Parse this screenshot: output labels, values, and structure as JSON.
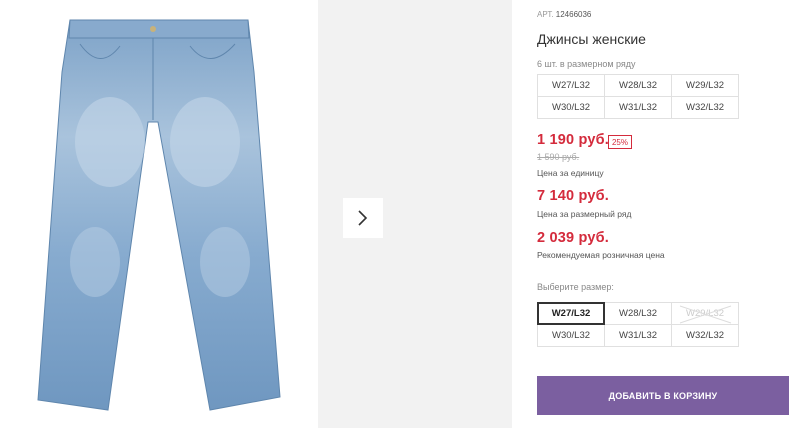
{
  "product": {
    "art_label": "АРТ.",
    "art_value": "12466036",
    "title": "Джинсы женские",
    "row_note": "6 шт. в размерном ряду"
  },
  "row_sizes": [
    "W27/L32",
    "W28/L32",
    "W29/L32",
    "W30/L32",
    "W31/L32",
    "W32/L32"
  ],
  "prices": {
    "unit_price": "1 190 руб.",
    "discount_badge": "25%",
    "old_price": "1 590 руб.",
    "unit_caption": "Цена за единицу",
    "row_price": "7 140 руб.",
    "row_caption": "Цена за размерный ряд",
    "retail_price": "2 039 руб.",
    "retail_caption": "Рекомендуемая розничная цена"
  },
  "size_picker": {
    "label": "Выберите размер:",
    "sizes": [
      {
        "label": "W27/L32",
        "state": "selected"
      },
      {
        "label": "W28/L32",
        "state": "available"
      },
      {
        "label": "W29/L32",
        "state": "unavailable"
      },
      {
        "label": "W30/L32",
        "state": "available"
      },
      {
        "label": "W31/L32",
        "state": "available"
      },
      {
        "label": "W32/L32",
        "state": "available"
      }
    ]
  },
  "cart": {
    "add_label": "Добавить в корзину"
  },
  "gallery": {
    "next_icon": "chevron-right-icon"
  },
  "colors": {
    "accent": "#7b5fa0",
    "price": "#d42b3c",
    "denim": "#7ea3c8"
  }
}
